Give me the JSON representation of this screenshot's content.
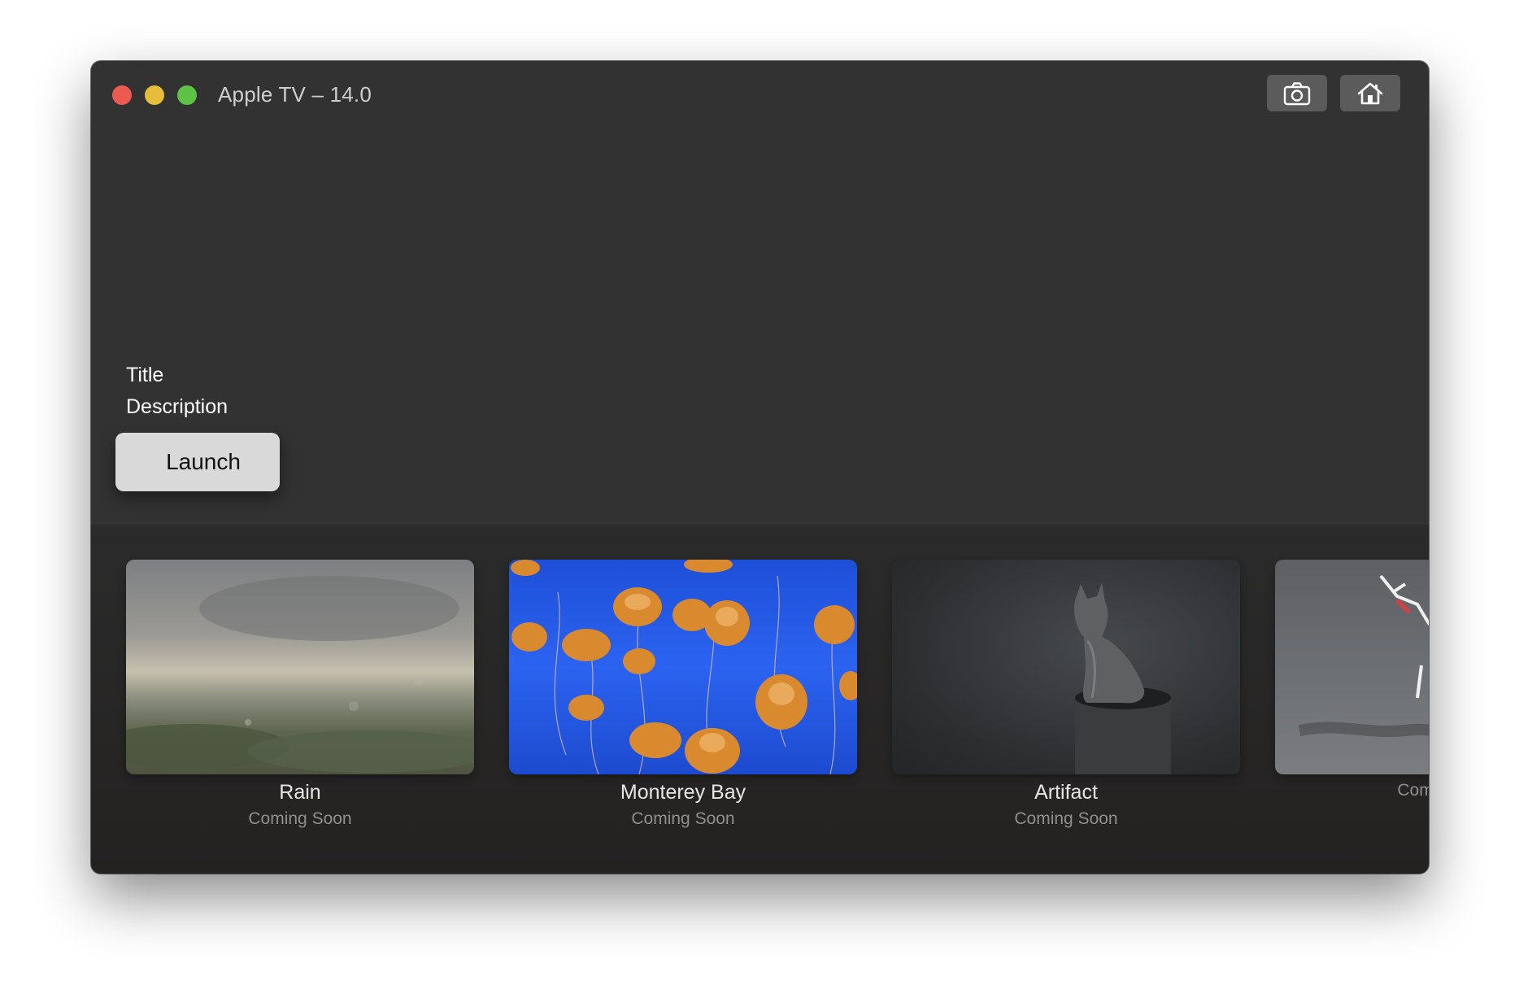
{
  "window": {
    "title": "Apple TV – 14.0"
  },
  "toolbar": {
    "screenshot_icon": "camera-icon",
    "home_icon": "home-icon"
  },
  "hero": {
    "title": "Title",
    "description": "Description",
    "launch_label": "Launch"
  },
  "shelf": {
    "items": [
      {
        "title": "Rain",
        "subtitle": "Coming Soon"
      },
      {
        "title": "Monterey Bay",
        "subtitle": "Coming Soon"
      },
      {
        "title": "Artifact",
        "subtitle": "Coming Soon"
      },
      {
        "title": "",
        "subtitle": "Coming Soon"
      }
    ]
  },
  "colors": {
    "window_bg": "#323232",
    "close": "#ee5a52",
    "minimize": "#e5bd3a",
    "zoom": "#5ec247",
    "button_bg": "#d9d9d9"
  }
}
